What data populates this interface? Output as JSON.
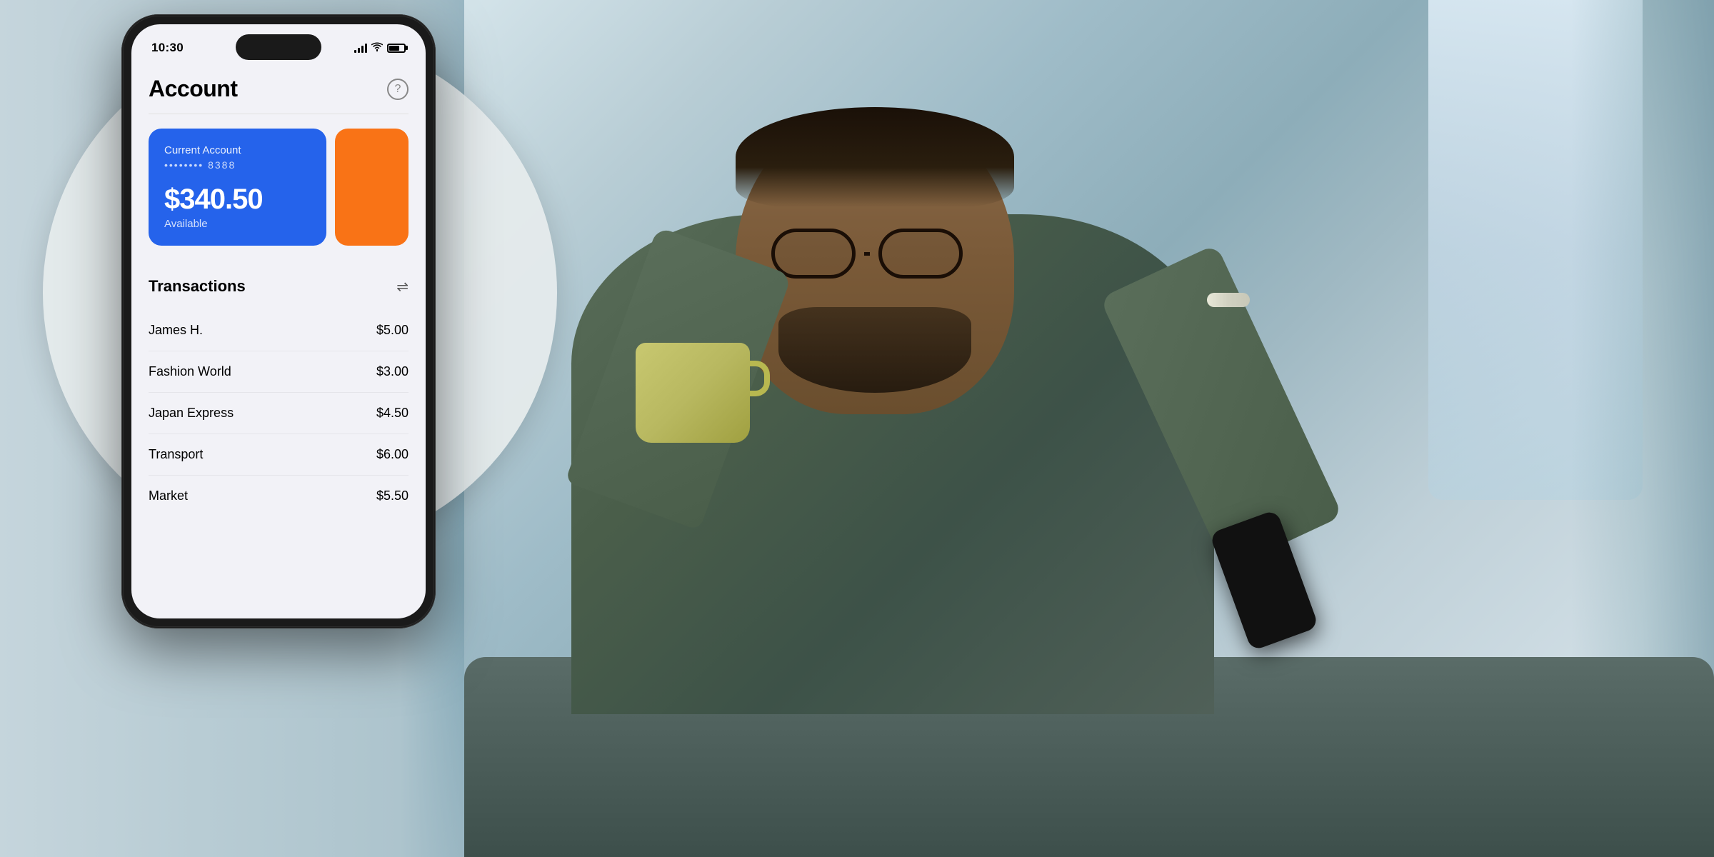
{
  "scene": {
    "background_color": "#b8cdd5"
  },
  "phone": {
    "status_bar": {
      "time": "10:30",
      "signal_label": "signal",
      "wifi_label": "wifi",
      "battery_label": "battery"
    },
    "app": {
      "title": "Account",
      "help_icon": "?",
      "account_card": {
        "type": "Current Account",
        "number": "•••••••• 8388",
        "balance": "$340.50",
        "available_label": "Available"
      },
      "transactions_section": {
        "title": "Transactions",
        "filter_icon": "⇌",
        "items": [
          {
            "name": "James H.",
            "amount": "$5.00"
          },
          {
            "name": "Fashion World",
            "amount": "$3.00"
          },
          {
            "name": "Japan Express",
            "amount": "$4.50"
          },
          {
            "name": "Transport",
            "amount": "$6.00"
          },
          {
            "name": "Market",
            "amount": "$5.50"
          }
        ]
      }
    }
  },
  "colors": {
    "blue_card": "#2563eb",
    "orange_card": "#f97316",
    "background": "#f2f2f7",
    "phone_frame": "#1a1a1a",
    "text_primary": "#000000",
    "text_secondary": "#888888"
  }
}
